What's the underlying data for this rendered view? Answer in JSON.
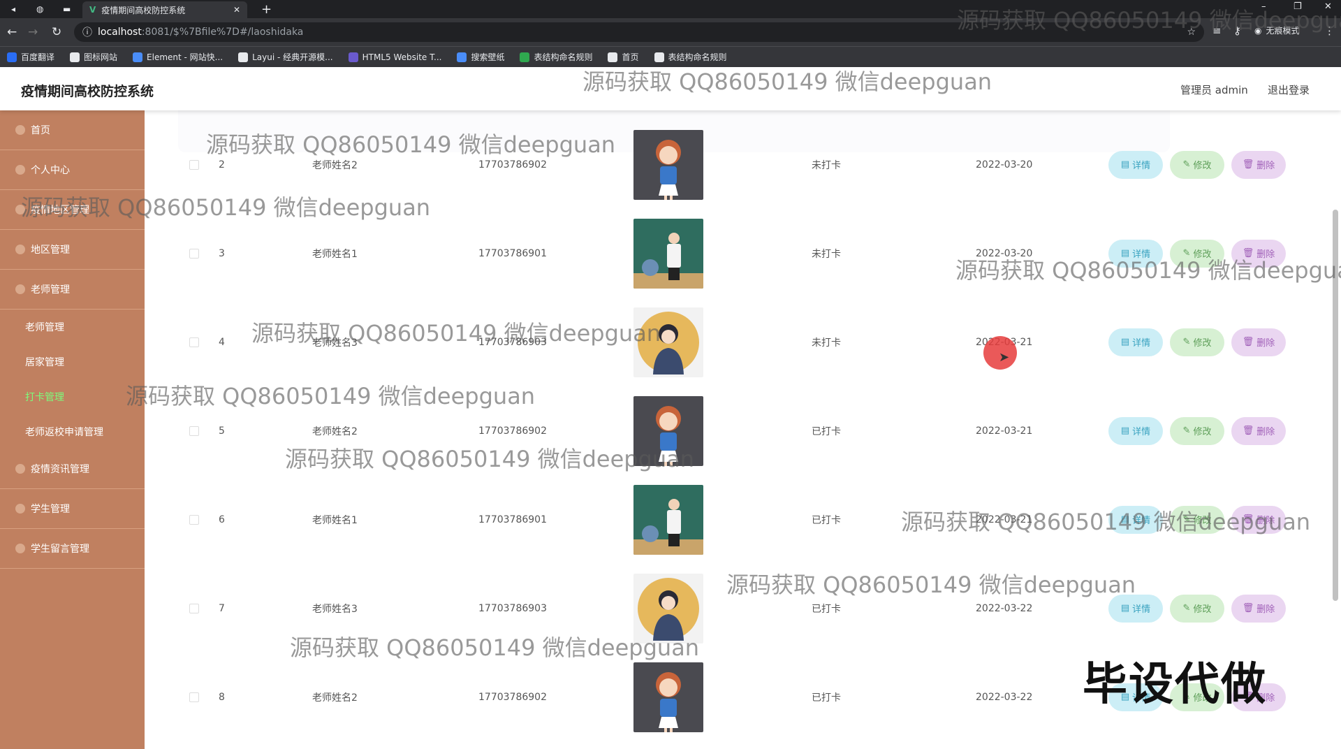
{
  "browser": {
    "tab_title": "疫情期间高校防控系统",
    "tab_favicon": "V",
    "new_tab": "+",
    "url_host": "localhost",
    "url_path": ":8081/$%7Bfile%7D#/laoshidaka",
    "profile_label": "无痕模式",
    "bookmarks": [
      "百度翻译",
      "图标网站",
      "Element - 网站快...",
      "Layui - 经典开源模...",
      "HTML5 Website T...",
      "搜索壁纸",
      "表结构命名规则",
      "首页",
      "表结构命名规则"
    ],
    "bookmark_colors": [
      "#2a6df4",
      "#e8eaed",
      "#4a8df8",
      "#e8eaed",
      "#6a5acd",
      "#4a8df8",
      "#2fa84f",
      "#e8eaed",
      "#e8eaed"
    ]
  },
  "header": {
    "title": "疫情期间高校防控系统",
    "user": "管理员 admin",
    "logout": "退出登录"
  },
  "sidebar": {
    "items": [
      {
        "label": "首页",
        "icon": "home-icon"
      },
      {
        "label": "个人中心",
        "icon": "user-icon"
      },
      {
        "label": "疫情地区管理",
        "icon": "user-icon"
      },
      {
        "label": "地区管理",
        "icon": "map-icon"
      },
      {
        "label": "老师管理",
        "icon": "teacher-icon"
      }
    ],
    "sub_items": [
      {
        "label": "老师管理",
        "active": false
      },
      {
        "label": "居家管理",
        "active": false
      },
      {
        "label": "打卡管理",
        "active": true
      },
      {
        "label": "老师返校申请管理",
        "active": false
      }
    ],
    "bottom_items": [
      {
        "label": "疫情资讯管理",
        "icon": "news-icon"
      },
      {
        "label": "学生管理",
        "icon": "student-icon"
      },
      {
        "label": "学生留言管理",
        "icon": "message-icon"
      }
    ]
  },
  "table": {
    "rows": [
      {
        "index": "2",
        "name": "老师姓名2",
        "phone": "17703786902",
        "status": "未打卡",
        "date": "2022-03-20",
        "photo": "cartoon-girl"
      },
      {
        "index": "3",
        "name": "老师姓名1",
        "phone": "17703786901",
        "status": "未打卡",
        "date": "2022-03-20",
        "photo": "teacher-classroom"
      },
      {
        "index": "4",
        "name": "老师姓名3",
        "phone": "17703786903",
        "status": "未打卡",
        "date": "2022-03-21",
        "photo": "woman-circle"
      },
      {
        "index": "5",
        "name": "老师姓名2",
        "phone": "17703786902",
        "status": "已打卡",
        "date": "2022-03-21",
        "photo": "cartoon-girl"
      },
      {
        "index": "6",
        "name": "老师姓名1",
        "phone": "17703786901",
        "status": "已打卡",
        "date": "2022-03-21",
        "photo": "teacher-classroom"
      },
      {
        "index": "7",
        "name": "老师姓名3",
        "phone": "17703786903",
        "status": "已打卡",
        "date": "2022-03-22",
        "photo": "woman-circle"
      },
      {
        "index": "8",
        "name": "老师姓名2",
        "phone": "17703786902",
        "status": "已打卡",
        "date": "2022-03-22",
        "photo": "cartoon-girl"
      }
    ],
    "actions": {
      "detail": "详情",
      "edit": "修改",
      "delete": "删除"
    }
  },
  "overlays": {
    "watermark": "源码获取 QQ86050149 微信deepguan",
    "banner": "毕设代做"
  },
  "colors": {
    "sidebar": "#c08060",
    "active_menu": "#7cfc7c",
    "detail_btn": "#cceef6",
    "edit_btn": "#d7f0d3",
    "delete_btn": "#ead6f1"
  }
}
